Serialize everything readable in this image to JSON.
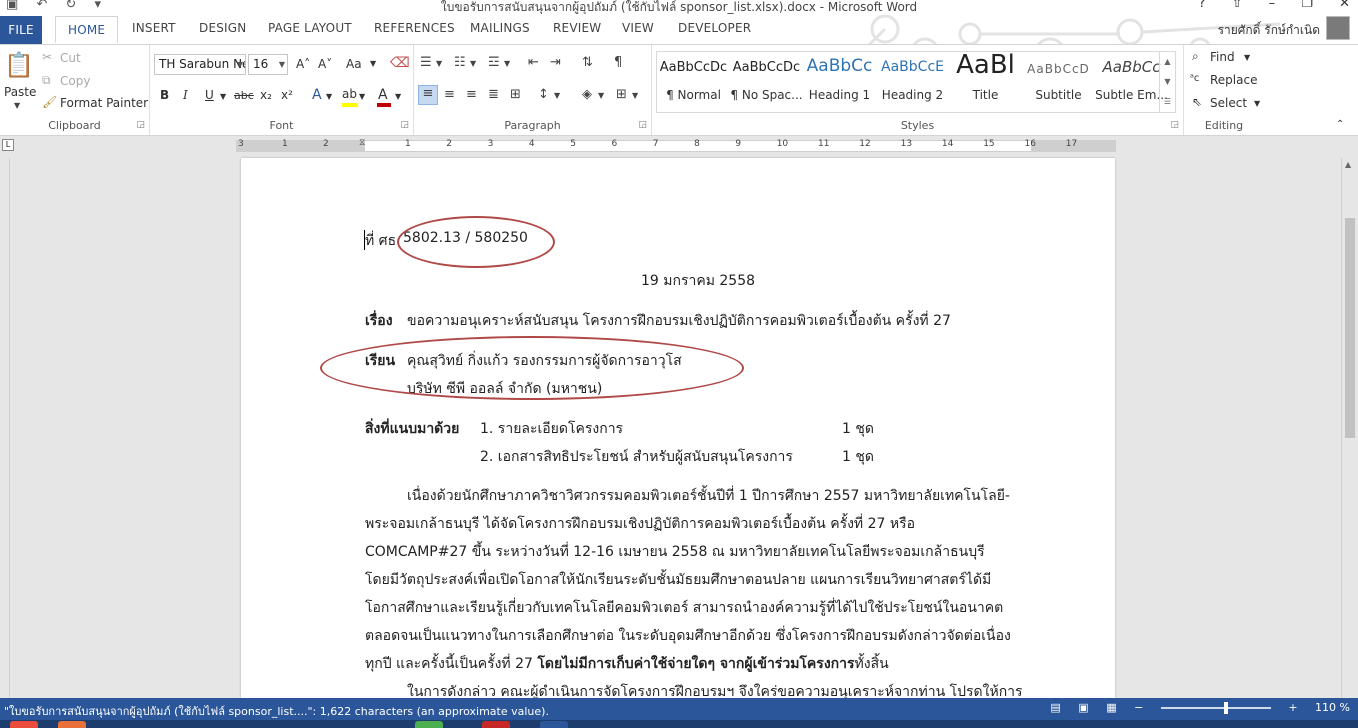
{
  "window": {
    "title": "ใบขอรับการสนับสนุนจากผู้อุปถัมภ์ (ใช้กับไฟล์ sponsor_list.xlsx).docx - Microsoft Word",
    "user_name": "รายศักดิ์ รักษ์กำเนิด"
  },
  "ribbon": {
    "tabs": [
      "FILE",
      "HOME",
      "INSERT",
      "DESIGN",
      "PAGE LAYOUT",
      "REFERENCES",
      "MAILINGS",
      "REVIEW",
      "VIEW",
      "DEVELOPER"
    ],
    "active_tab": "HOME",
    "clipboard": {
      "paste": "Paste",
      "cut": "Cut",
      "copy": "Copy",
      "format_painter": "Format Painter",
      "label": "Clipboard"
    },
    "font": {
      "font_name": "TH Sarabun Ne",
      "font_size": "16",
      "label": "Font",
      "bold": "B",
      "italic": "I",
      "underline": "U",
      "strike": "abc",
      "sub": "x₂",
      "sup": "x²",
      "grow": "A˄",
      "shrink": "A˅",
      "case": "Aa",
      "effects": "A",
      "highlight": "ab",
      "color": "A",
      "highlight_color": "#ffff00",
      "font_color": "#c00000"
    },
    "paragraph": {
      "label": "Paragraph"
    },
    "styles": {
      "label": "Styles",
      "items": [
        {
          "preview": "AaBbCcDc",
          "name": "¶ Normal"
        },
        {
          "preview": "AaBbCcDc",
          "name": "¶ No Spac..."
        },
        {
          "preview": "AaBbCc",
          "name": "Heading 1"
        },
        {
          "preview": "AaBbCcE",
          "name": "Heading 2"
        },
        {
          "preview": "AaBl",
          "name": "Title"
        },
        {
          "preview": "AaBbCcD",
          "name": "Subtitle"
        },
        {
          "preview": "AaBbCc",
          "name": "Subtle Em..."
        }
      ],
      "heading_color": "#2e74b5"
    },
    "editing": {
      "find": "Find",
      "replace": "Replace",
      "select": "Select",
      "label": "Editing"
    }
  },
  "ruler": {
    "numbers": [
      "3",
      "1",
      "2",
      "1",
      "2",
      "3",
      "4",
      "5",
      "6",
      "7",
      "8",
      "9",
      "10",
      "11",
      "12",
      "13",
      "14",
      "15",
      "16",
      "17"
    ]
  },
  "document": {
    "ref_prefix": "ที่ ศธ",
    "ref_number": "5802.13 / 580250",
    "date": "19 มกราคม 2558",
    "subject_label": "เรื่อง",
    "subject": "ขอความอนุเคราะห์สนับสนุน โครงการฝึกอบรมเชิงปฏิบัติการคอมพิวเตอร์เบื้องต้น ครั้งที่ 27",
    "to_label": "เรียน",
    "to_line1": "คุณสุวิทย์ กิ่งแก้ว รองกรรมการผู้จัดการอาวุโส",
    "to_line2": "บริษัท ซีพี ออลล์ จำกัด (มหาชน)",
    "attach_label": "สิ่งที่แนบมาด้วย",
    "attachments": [
      {
        "item": "1. รายละเอียดโครงการ",
        "qty": "1 ชุด"
      },
      {
        "item": "2. เอกสารสิทธิประโยชน์ สำหรับผู้สนับสนุนโครงการ",
        "qty": "1 ชุด"
      }
    ],
    "body_lines": [
      "เนื่องด้วยนักศึกษาภาควิชาวิศวกรรมคอมพิวเตอร์ชั้นปีที่ 1 ปีการศึกษา 2557 มหาวิทยาลัยเทคโนโลยี-",
      "พระจอมเกล้าธนบุรี ได้จัดโครงการฝึกอบรมเชิงปฏิบัติการคอมพิวเตอร์เบื้องต้น ครั้งที่ 27 หรือ",
      "COMCAMP#27 ขึ้น ระหว่างวันที่ 12-16 เมษายน 2558 ณ มหาวิทยาลัยเทคโนโลยีพระจอมเกล้าธนบุรี",
      "โดยมีวัตถุประสงค์เพื่อเปิดโอกาสให้นักเรียนระดับชั้นมัธยมศึกษาตอนปลาย แผนการเรียนวิทยาศาสตร์ได้มี",
      "โอกาสศึกษาและเรียนรู้เกี่ยวกับเทคโนโลยีคอมพิวเตอร์ สามารถนำองค์ความรู้ที่ได้ไปใช้ประโยชน์ในอนาคต",
      "ตลอดจนเป็นแนวทางในการเลือกศึกษาต่อ ในระดับอุดมศึกษาอีกด้วย ซึ่งโครงการฝึกอบรมดังกล่าวจัดต่อเนื่อง"
    ],
    "last_line_normal": "ทุกปี และครั้งนี้เป็นครั้งที่ 27",
    "last_line_bold": "โดยไม่มีการเก็บค่าใช้จ่ายใดๆ จากผู้เข้าร่วมโครงการ",
    "last_line_end": "ทั้งสิ้น",
    "next_para": "ในการดังกล่าว คณะผู้ดำเนินการจัดโครงการฝึกอบรมฯ จึงใคร่ขอความอนุเคราะห์จากท่าน โปรดให้การ",
    "annotation_color": "#b04a48"
  },
  "status_bar": {
    "text": "\"ใบขอรับการสนับสนุนจากผู้อุปถัมภ์ (ใช้กับไฟล์ sponsor_list....\": 1,622 characters (an approximate value).",
    "zoom": "110 %",
    "zoom_fraction": 0.6,
    "bg_color": "#2b579a"
  }
}
